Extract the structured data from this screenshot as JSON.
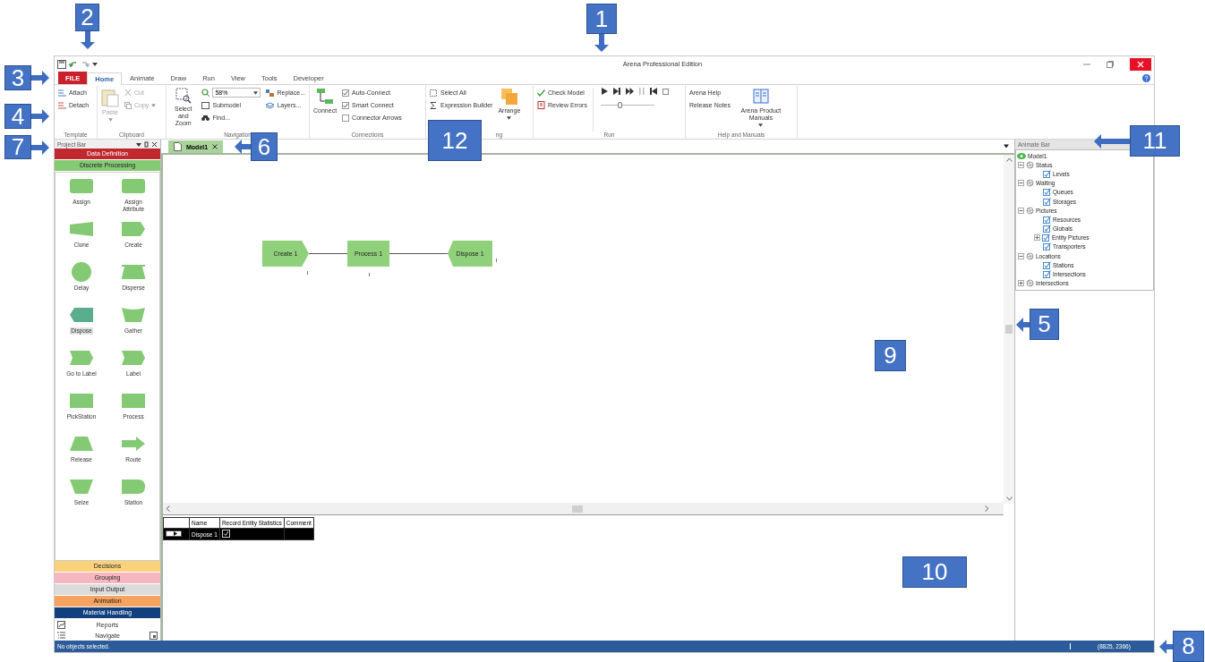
{
  "window": {
    "title": "Arena Professional Edition"
  },
  "ribbon_tabs": [
    {
      "label": "FILE",
      "kind": "file",
      "selected": false
    },
    {
      "label": "Home",
      "kind": "tab",
      "selected": true
    },
    {
      "label": "Animate",
      "kind": "tab",
      "selected": false
    },
    {
      "label": "Draw",
      "kind": "tab",
      "selected": false
    },
    {
      "label": "Run",
      "kind": "tab",
      "selected": false
    },
    {
      "label": "View",
      "kind": "tab",
      "selected": false
    },
    {
      "label": "Tools",
      "kind": "tab",
      "selected": false
    },
    {
      "label": "Developer",
      "kind": "tab",
      "selected": false
    }
  ],
  "ribbon": {
    "template": {
      "label": "Template",
      "attach": "Attach",
      "detach": "Detach"
    },
    "clipboard": {
      "label": "Clipboard",
      "items": [
        {
          "label": "Paste",
          "disabled": true
        },
        {
          "label": "Cut",
          "disabled": true
        },
        {
          "label": "Copy",
          "disabled": true
        }
      ]
    },
    "navigation": {
      "label": "Navigation",
      "select_zoom": "Select and Zoom",
      "zoom": "58%",
      "submodel": "Submodel",
      "find": "Find...",
      "replace": "Replace...",
      "layers": "Layers..."
    },
    "connections": {
      "label": "Connections",
      "connect": "Connect",
      "options": [
        {
          "label": "Auto-Connect",
          "checked": true
        },
        {
          "label": "Smart Connect",
          "checked": true
        },
        {
          "label": "Connector Arrows",
          "checked": false
        }
      ]
    },
    "interaction": {
      "label": "ng",
      "select_all": "Select All",
      "expression_builder": "Expression Builder",
      "arrange": "Arrange"
    },
    "run": {
      "label": "Run",
      "check_model": "Check Model",
      "review_errors": "Review Errors",
      "speed": {
        "level": 0.35
      }
    },
    "help": {
      "label": "Help and Manuals",
      "arena_help": "Arena Help",
      "release_notes": "Release Notes",
      "manuals": "Arena Product Manuals"
    }
  },
  "project_bar": {
    "title": "Project Bar",
    "panels": [
      {
        "label": "Data Definition",
        "color": "#c0282f"
      },
      {
        "label": "Discrete Processing",
        "color": "#84c973",
        "modules": [
          {
            "label": "Assign",
            "kind": "rounded",
            "selected": false
          },
          {
            "label": "Assign Attribute",
            "kind": "rounded",
            "selected": false
          },
          {
            "label": "Clone",
            "kind": "clone",
            "selected": false
          },
          {
            "label": "Create",
            "kind": "create",
            "selected": false
          },
          {
            "label": "Delay",
            "kind": "circle",
            "selected": false
          },
          {
            "label": "Disperse",
            "kind": "disperse",
            "selected": false
          },
          {
            "label": "Dispose",
            "kind": "dispose",
            "selected": true
          },
          {
            "label": "Gather",
            "kind": "gather",
            "selected": false
          },
          {
            "label": "Go to Label",
            "kind": "label",
            "selected": false
          },
          {
            "label": "Label",
            "kind": "label",
            "selected": false
          },
          {
            "label": "PickStation",
            "kind": "rect",
            "selected": false
          },
          {
            "label": "Process",
            "kind": "rect",
            "selected": false
          },
          {
            "label": "Release",
            "kind": "release",
            "selected": false
          },
          {
            "label": "Route",
            "kind": "route",
            "selected": false
          },
          {
            "label": "Seize",
            "kind": "seize",
            "selected": false
          },
          {
            "label": "Station",
            "kind": "station",
            "selected": false
          }
        ]
      },
      {
        "label": "Decisions",
        "color": "#fbd27c"
      },
      {
        "label": "Grouping",
        "color": "#f7b6c0"
      },
      {
        "label": "Input Output",
        "color": "#dcdcdc"
      },
      {
        "label": "Animation",
        "color": "#f5a35f"
      },
      {
        "label": "Material Handling",
        "color": "#10407d"
      }
    ],
    "footer_items": [
      {
        "label": "Reports"
      },
      {
        "label": "Navigate"
      }
    ]
  },
  "model_tabs": [
    {
      "label": "Model1",
      "selected": true
    }
  ],
  "flowchart": [
    {
      "label": "Create 1",
      "kind": "create"
    },
    {
      "label": "Process 1",
      "kind": "process"
    },
    {
      "label": "Dispose 1",
      "kind": "dispose"
    }
  ],
  "spreadsheet": {
    "columns": [
      "Name",
      "Record Entity Statistics",
      "Comment"
    ],
    "rows": [
      {
        "selected": true,
        "name": "Dispose 1",
        "record_entity_statistics": true
      }
    ]
  },
  "animate_bar": {
    "title": "Animate Bar",
    "tree": [
      {
        "label": "Model1",
        "kind": "root",
        "children": [
          {
            "label": "Status",
            "kind": "group",
            "expanded": true,
            "children": [
              {
                "label": "Levels",
                "kind": "item",
                "checked": true
              }
            ]
          },
          {
            "label": "Waiting",
            "kind": "group",
            "expanded": true,
            "children": [
              {
                "label": "Queues",
                "kind": "item",
                "checked": true
              },
              {
                "label": "Storages",
                "kind": "item",
                "checked": true
              }
            ]
          },
          {
            "label": "Pictures",
            "kind": "group",
            "expanded": true,
            "children": [
              {
                "label": "Resources",
                "kind": "item",
                "checked": true
              },
              {
                "label": "Globals",
                "kind": "item",
                "checked": true
              },
              {
                "label": "Entity Pictures",
                "kind": "item",
                "checked": true,
                "expanded": false
              },
              {
                "label": "Transporters",
                "kind": "item",
                "checked": true
              }
            ]
          },
          {
            "label": "Locations",
            "kind": "group",
            "expanded": true,
            "children": [
              {
                "label": "Stations",
                "kind": "item",
                "checked": true
              },
              {
                "label": "Intersections",
                "kind": "item",
                "checked": true
              }
            ]
          },
          {
            "label": "Intersections",
            "kind": "group",
            "expanded": false
          }
        ]
      }
    ]
  },
  "status_bar": {
    "message": "No objects selected.",
    "coordinates": "(8825, 2366)"
  },
  "callouts": [
    {
      "number": "2",
      "kind": "down"
    },
    {
      "number": "1",
      "kind": "down"
    },
    {
      "number": "3",
      "kind": "right"
    },
    {
      "number": "4",
      "kind": "right"
    },
    {
      "number": "7",
      "kind": "right"
    },
    {
      "number": "6",
      "kind": "left"
    },
    {
      "number": "12",
      "kind": "plain"
    },
    {
      "number": "11",
      "kind": "left"
    },
    {
      "number": "5",
      "kind": "left"
    },
    {
      "number": "9",
      "kind": "plain"
    },
    {
      "number": "10",
      "kind": "plain"
    },
    {
      "number": "8",
      "kind": "left"
    }
  ]
}
